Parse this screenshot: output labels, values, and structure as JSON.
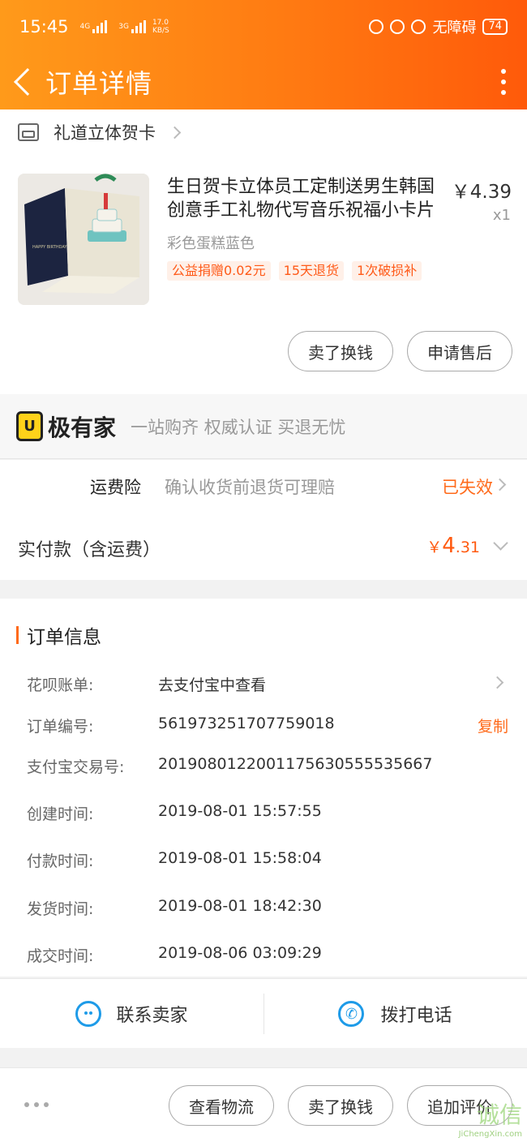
{
  "status_bar": {
    "time": "15:45",
    "network_1": "4G",
    "network_2": "3G",
    "speed": "17.0",
    "speed_unit": "KB/S",
    "accessibility": "无障碍",
    "battery": "74"
  },
  "nav": {
    "title": "订单详情"
  },
  "shop": {
    "name": "礼道立体贺卡"
  },
  "product": {
    "title": "生日贺卡立体员工定制送男生韩国创意手工礼物代写音乐祝福小卡片",
    "price": "￥4.39",
    "quantity": "x1",
    "sku": "彩色蛋糕蓝色",
    "tags": [
      "公益捐赠0.02元",
      "15天退货",
      "1次破损补"
    ],
    "image_caption": "HAPPY BIRTHDAY"
  },
  "item_actions": {
    "sell_label": "卖了换钱",
    "after_sale_label": "申请售后"
  },
  "brand": {
    "logo_text": "U",
    "name": "极有家",
    "slogan": "一站购齐 权威认证 买退无忧"
  },
  "insurance": {
    "label": "运费险",
    "desc": "确认收货前退货可理赔",
    "status": "已失效"
  },
  "payment": {
    "label": "实付款（含运费）",
    "currency": "￥",
    "amount_int": "4",
    "amount_dec": ".31"
  },
  "order_info": {
    "title": "订单信息",
    "rows": [
      {
        "key": "花呗账单:",
        "value": "去支付宝中查看"
      },
      {
        "key": "订单编号:",
        "value": "561973251707759018",
        "action": "复制"
      },
      {
        "key": "支付宝交易号:",
        "value": "2019080122001175630555535667"
      },
      {
        "key": "创建时间:",
        "value": "2019-08-01 15:57:55"
      },
      {
        "key": "付款时间:",
        "value": "2019-08-01 15:58:04"
      },
      {
        "key": "发货时间:",
        "value": "2019-08-01 18:42:30"
      },
      {
        "key": "成交时间:",
        "value": "2019-08-06 03:09:29"
      }
    ]
  },
  "contact": {
    "seller_label": "联系卖家",
    "call_label": "拨打电话"
  },
  "bottom_bar": {
    "logistics_label": "查看物流",
    "sell_label": "卖了换钱",
    "review_label": "追加评价"
  },
  "watermark": {
    "text": "诚信",
    "url": "JiChengXin.com"
  },
  "colors": {
    "header_start": "#ff9a1a",
    "header_end": "#ff5a0a",
    "accent": "#ff6a1a",
    "link_blue": "#1e9be8",
    "brand_yellow": "#ffd21a"
  }
}
